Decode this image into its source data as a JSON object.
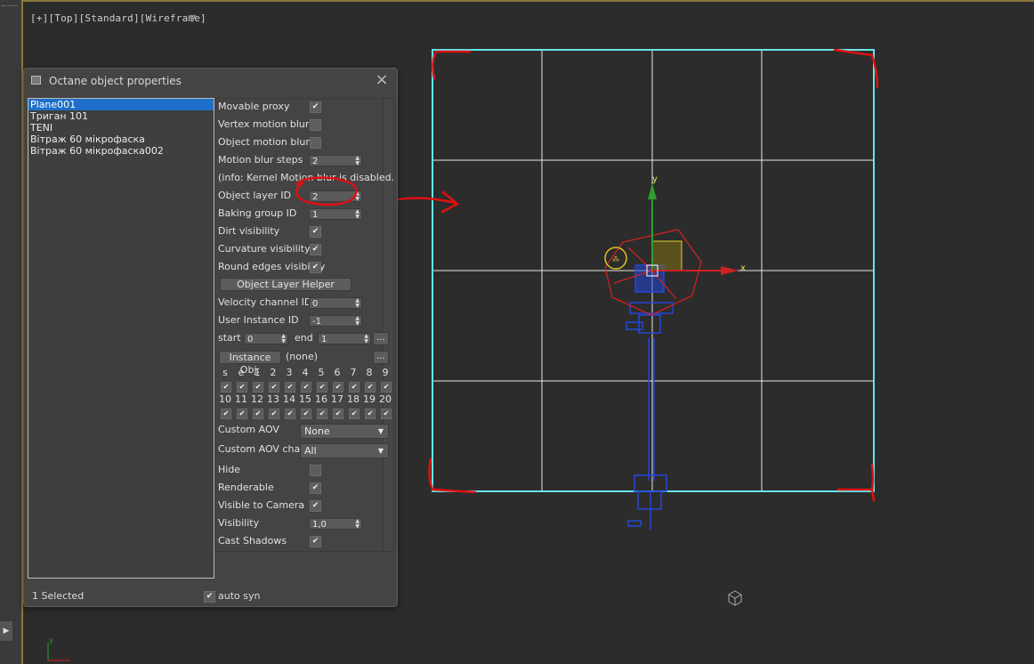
{
  "viewport": {
    "label": "[+][Top][Standard][Wireframe]",
    "filter_icon": "funnel-icon",
    "axis_x": "x",
    "axis_y": "y"
  },
  "colors": {
    "viewport_bg": "#2c2c2c",
    "selection_cyan": "#66e6ea",
    "grid_white": "#e8e8e8",
    "gizmo_red": "#cc2222",
    "gizmo_green": "#2ea02e",
    "object_blue": "#2547d8",
    "annotation_red": "#e01010",
    "list_selection": "#1e6fc9"
  },
  "dialog": {
    "title": "Octane object properties",
    "objects": [
      "Plane001",
      "Триган 101",
      "TENI",
      "Вітраж 60 мікрофаска",
      "Вітраж 60 мікрофаска002"
    ],
    "selected_index": 0,
    "props": {
      "movable_proxy": {
        "label": "Movable proxy",
        "checked": true
      },
      "vertex_motion_blur": {
        "label": "Vertex motion blur",
        "checked": false
      },
      "object_motion_blur": {
        "label": "Object motion blur",
        "checked": false
      },
      "motion_blur_steps": {
        "label": "Motion blur steps",
        "value": "2"
      },
      "info": "(info: Kernel Motion blur is disabled.)",
      "object_layer_id": {
        "label": "Object layer ID",
        "value": "2"
      },
      "baking_group_id": {
        "label": "Baking group ID",
        "value": "1"
      },
      "dirt_visibility": {
        "label": "Dirt visibility",
        "checked": true
      },
      "curvature_visibility": {
        "label": "Curvature visibility",
        "checked": true
      },
      "round_edges_visibility": {
        "label": "Round edges visibility",
        "checked": true
      },
      "object_layer_helper": "Object Layer Helper",
      "velocity_channel_id": {
        "label": "Velocity channel ID",
        "value": "0"
      },
      "user_instance_id": {
        "label": "User Instance ID",
        "value": "-1"
      },
      "start_label": "start",
      "start_value": "0",
      "end_label": "end",
      "end_value": "1",
      "ellipsis": "...",
      "instance_obj_button": "Instance Obj:",
      "instance_obj_value": "(none)",
      "channels_row1": [
        "s",
        "e",
        "1",
        "2",
        "3",
        "4",
        "5",
        "6",
        "7",
        "8",
        "9"
      ],
      "channels_row2": [
        "10",
        "11",
        "12",
        "13",
        "14",
        "15",
        "16",
        "17",
        "18",
        "19",
        "20"
      ],
      "custom_aov": {
        "label": "Custom AOV",
        "value": "None"
      },
      "custom_aov_channel": {
        "label": "Custom AOV chan.",
        "value": "All"
      },
      "hide": {
        "label": "Hide",
        "checked": false
      },
      "renderable": {
        "label": "Renderable",
        "checked": true
      },
      "visible_to_camera": {
        "label": "Visible to Camera",
        "checked": true
      },
      "visibility": {
        "label": "Visibility",
        "value": "1,0"
      },
      "cast_shadows": {
        "label": "Cast Shadows",
        "checked": true
      }
    },
    "footer": {
      "selected_text": "1 Selected",
      "auto_syn_label": "auto syn",
      "auto_syn_checked": true
    }
  }
}
